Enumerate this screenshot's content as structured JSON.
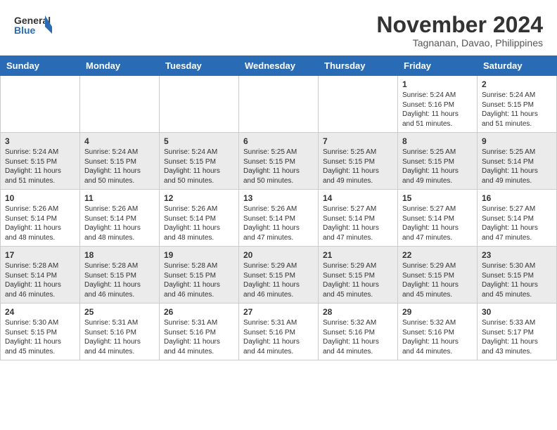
{
  "header": {
    "logo_line1": "General",
    "logo_line2": "Blue",
    "month_title": "November 2024",
    "location": "Tagnanan, Davao, Philippines"
  },
  "days_of_week": [
    "Sunday",
    "Monday",
    "Tuesday",
    "Wednesday",
    "Thursday",
    "Friday",
    "Saturday"
  ],
  "weeks": [
    [
      {
        "day": "",
        "info": ""
      },
      {
        "day": "",
        "info": ""
      },
      {
        "day": "",
        "info": ""
      },
      {
        "day": "",
        "info": ""
      },
      {
        "day": "",
        "info": ""
      },
      {
        "day": "1",
        "info": "Sunrise: 5:24 AM\nSunset: 5:16 PM\nDaylight: 11 hours\nand 51 minutes."
      },
      {
        "day": "2",
        "info": "Sunrise: 5:24 AM\nSunset: 5:15 PM\nDaylight: 11 hours\nand 51 minutes."
      }
    ],
    [
      {
        "day": "3",
        "info": "Sunrise: 5:24 AM\nSunset: 5:15 PM\nDaylight: 11 hours\nand 51 minutes."
      },
      {
        "day": "4",
        "info": "Sunrise: 5:24 AM\nSunset: 5:15 PM\nDaylight: 11 hours\nand 50 minutes."
      },
      {
        "day": "5",
        "info": "Sunrise: 5:24 AM\nSunset: 5:15 PM\nDaylight: 11 hours\nand 50 minutes."
      },
      {
        "day": "6",
        "info": "Sunrise: 5:25 AM\nSunset: 5:15 PM\nDaylight: 11 hours\nand 50 minutes."
      },
      {
        "day": "7",
        "info": "Sunrise: 5:25 AM\nSunset: 5:15 PM\nDaylight: 11 hours\nand 49 minutes."
      },
      {
        "day": "8",
        "info": "Sunrise: 5:25 AM\nSunset: 5:15 PM\nDaylight: 11 hours\nand 49 minutes."
      },
      {
        "day": "9",
        "info": "Sunrise: 5:25 AM\nSunset: 5:14 PM\nDaylight: 11 hours\nand 49 minutes."
      }
    ],
    [
      {
        "day": "10",
        "info": "Sunrise: 5:26 AM\nSunset: 5:14 PM\nDaylight: 11 hours\nand 48 minutes."
      },
      {
        "day": "11",
        "info": "Sunrise: 5:26 AM\nSunset: 5:14 PM\nDaylight: 11 hours\nand 48 minutes."
      },
      {
        "day": "12",
        "info": "Sunrise: 5:26 AM\nSunset: 5:14 PM\nDaylight: 11 hours\nand 48 minutes."
      },
      {
        "day": "13",
        "info": "Sunrise: 5:26 AM\nSunset: 5:14 PM\nDaylight: 11 hours\nand 47 minutes."
      },
      {
        "day": "14",
        "info": "Sunrise: 5:27 AM\nSunset: 5:14 PM\nDaylight: 11 hours\nand 47 minutes."
      },
      {
        "day": "15",
        "info": "Sunrise: 5:27 AM\nSunset: 5:14 PM\nDaylight: 11 hours\nand 47 minutes."
      },
      {
        "day": "16",
        "info": "Sunrise: 5:27 AM\nSunset: 5:14 PM\nDaylight: 11 hours\nand 47 minutes."
      }
    ],
    [
      {
        "day": "17",
        "info": "Sunrise: 5:28 AM\nSunset: 5:14 PM\nDaylight: 11 hours\nand 46 minutes."
      },
      {
        "day": "18",
        "info": "Sunrise: 5:28 AM\nSunset: 5:15 PM\nDaylight: 11 hours\nand 46 minutes."
      },
      {
        "day": "19",
        "info": "Sunrise: 5:28 AM\nSunset: 5:15 PM\nDaylight: 11 hours\nand 46 minutes."
      },
      {
        "day": "20",
        "info": "Sunrise: 5:29 AM\nSunset: 5:15 PM\nDaylight: 11 hours\nand 46 minutes."
      },
      {
        "day": "21",
        "info": "Sunrise: 5:29 AM\nSunset: 5:15 PM\nDaylight: 11 hours\nand 45 minutes."
      },
      {
        "day": "22",
        "info": "Sunrise: 5:29 AM\nSunset: 5:15 PM\nDaylight: 11 hours\nand 45 minutes."
      },
      {
        "day": "23",
        "info": "Sunrise: 5:30 AM\nSunset: 5:15 PM\nDaylight: 11 hours\nand 45 minutes."
      }
    ],
    [
      {
        "day": "24",
        "info": "Sunrise: 5:30 AM\nSunset: 5:15 PM\nDaylight: 11 hours\nand 45 minutes."
      },
      {
        "day": "25",
        "info": "Sunrise: 5:31 AM\nSunset: 5:16 PM\nDaylight: 11 hours\nand 44 minutes."
      },
      {
        "day": "26",
        "info": "Sunrise: 5:31 AM\nSunset: 5:16 PM\nDaylight: 11 hours\nand 44 minutes."
      },
      {
        "day": "27",
        "info": "Sunrise: 5:31 AM\nSunset: 5:16 PM\nDaylight: 11 hours\nand 44 minutes."
      },
      {
        "day": "28",
        "info": "Sunrise: 5:32 AM\nSunset: 5:16 PM\nDaylight: 11 hours\nand 44 minutes."
      },
      {
        "day": "29",
        "info": "Sunrise: 5:32 AM\nSunset: 5:16 PM\nDaylight: 11 hours\nand 44 minutes."
      },
      {
        "day": "30",
        "info": "Sunrise: 5:33 AM\nSunset: 5:17 PM\nDaylight: 11 hours\nand 43 minutes."
      }
    ]
  ]
}
